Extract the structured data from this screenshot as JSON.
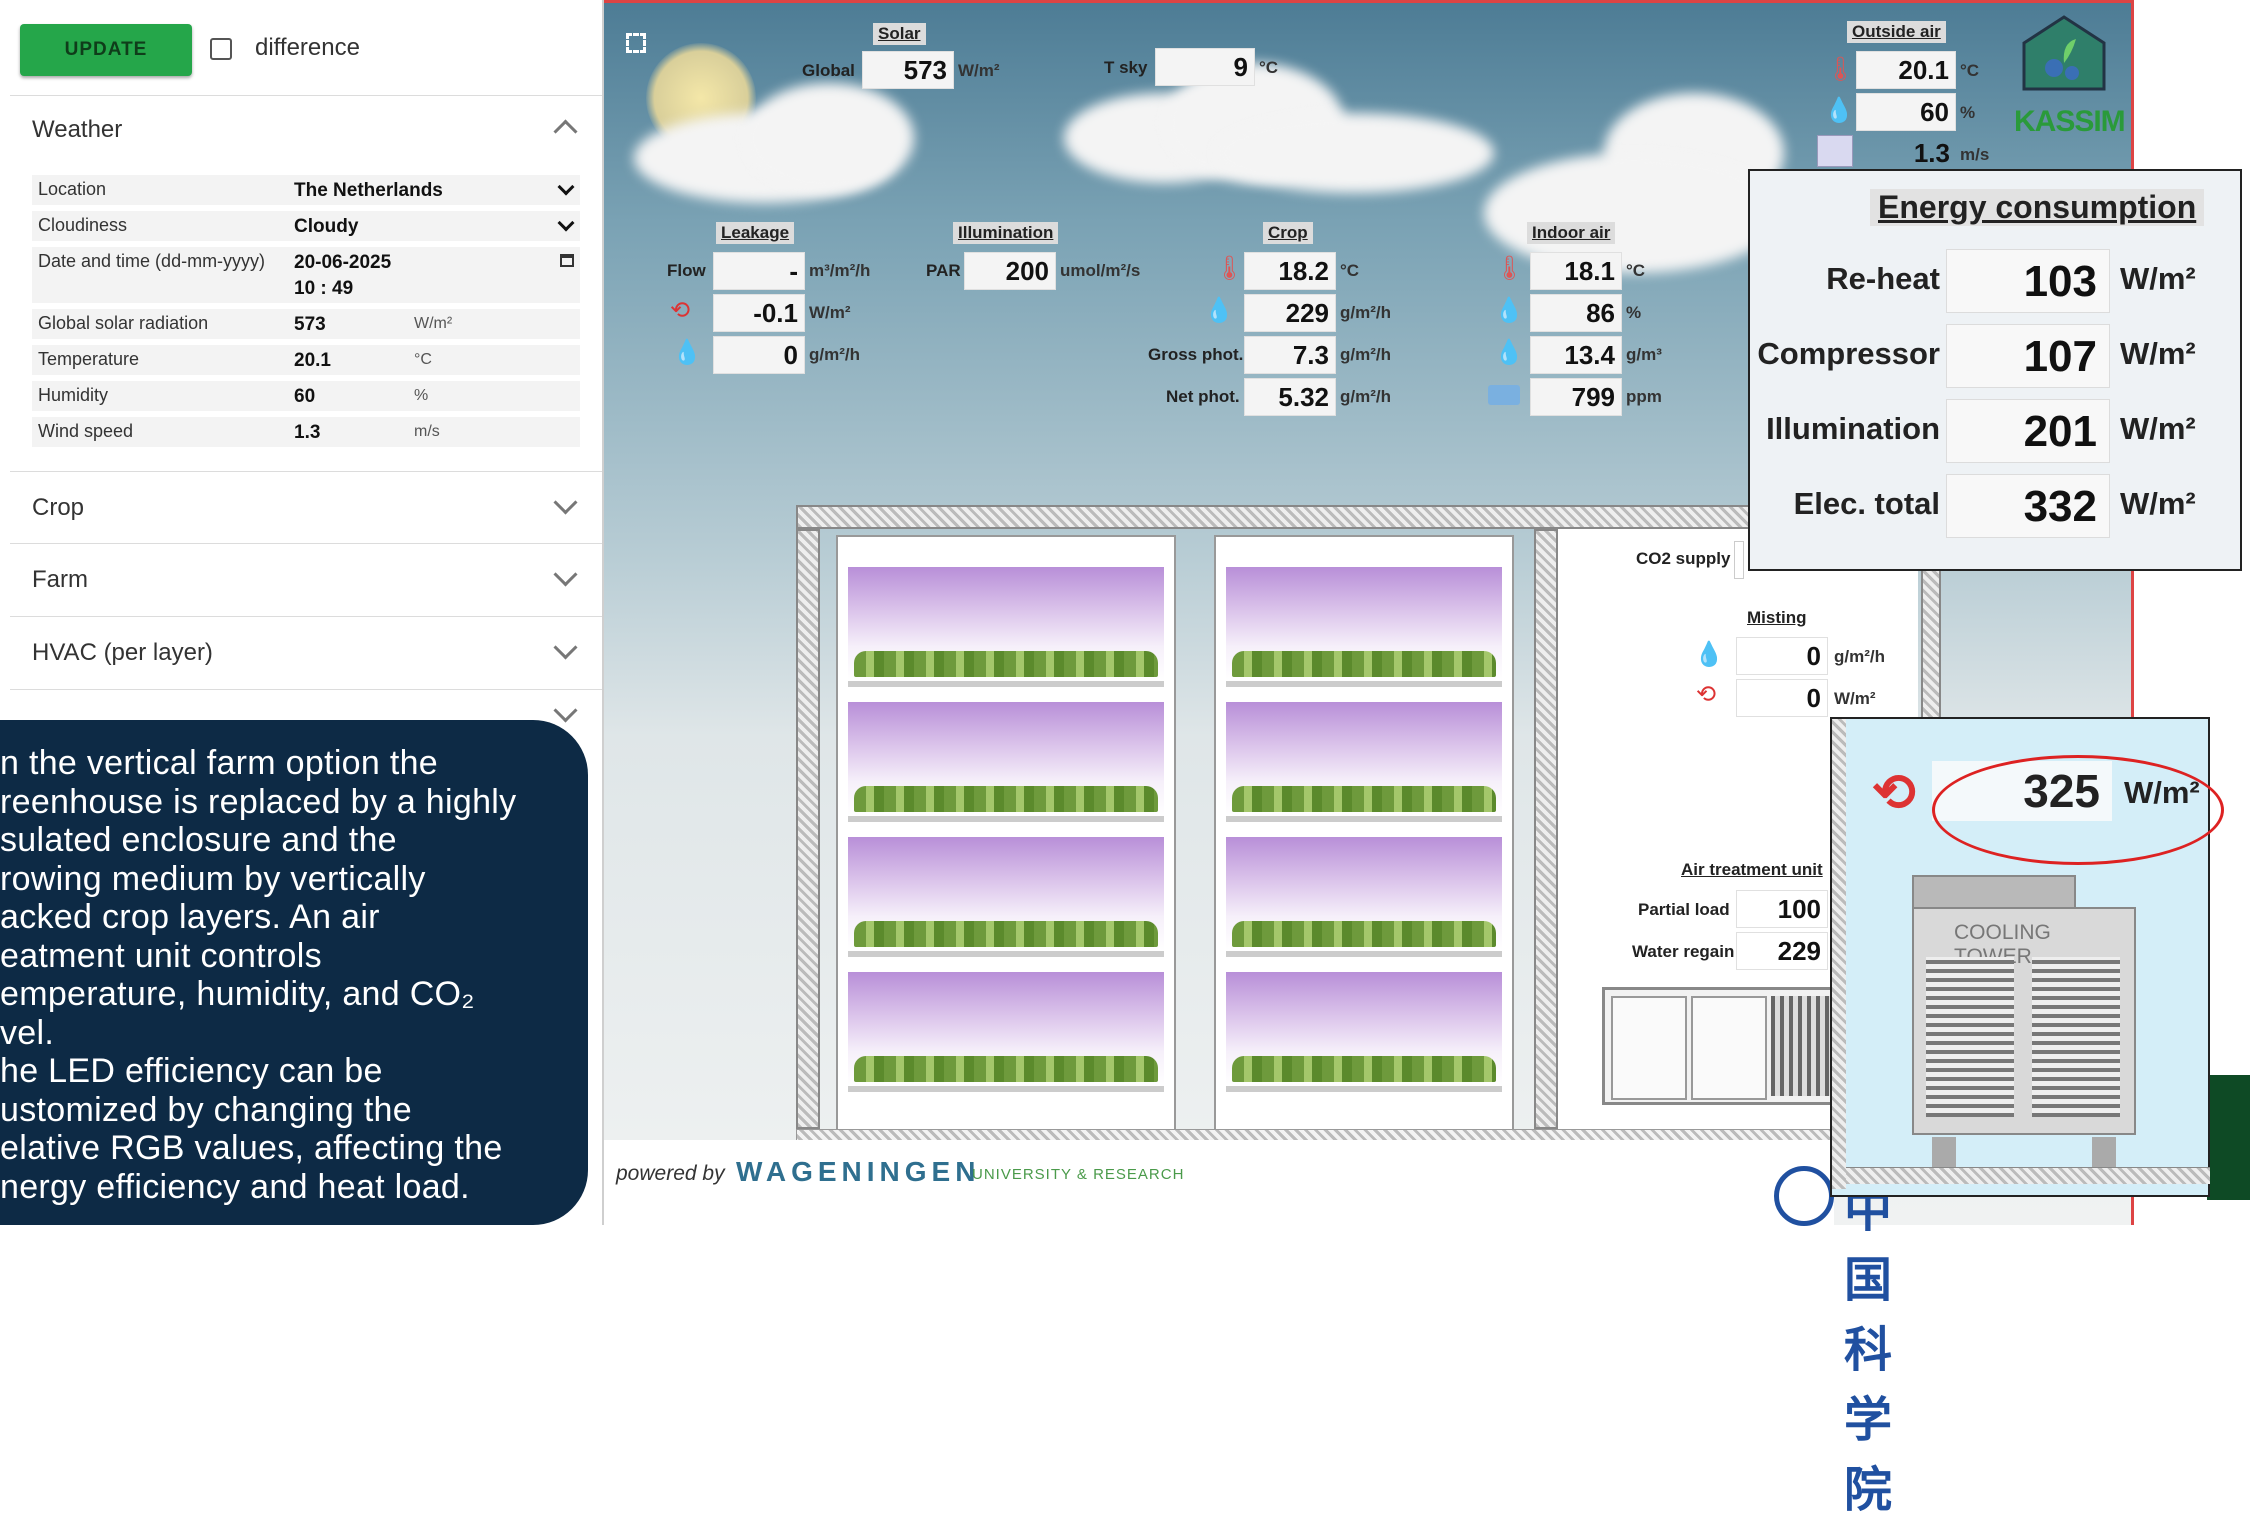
{
  "toolbar": {
    "update_label": "UPDATE",
    "difference_label": "difference"
  },
  "weather": {
    "title": "Weather",
    "rows": [
      {
        "label": "Location",
        "value": "The Netherlands",
        "unit": ""
      },
      {
        "label": "Cloudiness",
        "value": "Cloudy",
        "unit": ""
      },
      {
        "label": "Date and time (dd-mm-yyyy)",
        "value": "20-06-2025",
        "value2": "10 : 49",
        "unit": ""
      },
      {
        "label": "Global solar radiation",
        "value": "573",
        "unit": "W/m²"
      },
      {
        "label": "Temperature",
        "value": "20.1",
        "unit": "°C"
      },
      {
        "label": "Humidity",
        "value": "60",
        "unit": "%"
      },
      {
        "label": "Wind speed",
        "value": "1.3",
        "unit": "m/s"
      }
    ]
  },
  "sections": {
    "crop": "Crop",
    "farm": "Farm",
    "hvac": "HVAC (per layer)"
  },
  "tooltip": {
    "text": "n the vertical farm option the\nreenhouse is replaced by a highly\nsulated enclosure and the\nrowing medium by vertically\nacked crop layers.  An air\neatment unit controls\nemperature, humidity, and CO₂\nvel.\nhe LED efficiency can be\nustomized by changing the\nelative RGB values, affecting the\nnergy efficiency and heat load."
  },
  "solar": {
    "title": "Solar",
    "global_label": "Global",
    "global_value": "573",
    "global_unit": "W/m²",
    "tsky_label": "T sky",
    "tsky_value": "9",
    "tsky_unit": "°C"
  },
  "outside_air": {
    "title": "Outside air",
    "temp": "20.1",
    "temp_unit": "°C",
    "humidity": "60",
    "humidity_unit": "%",
    "wind": "1.3",
    "wind_unit": "m/s"
  },
  "brand": {
    "logo_text": "KASSIM"
  },
  "leakage": {
    "title": "Leakage",
    "flow_label": "Flow",
    "flow_value": "-",
    "flow_unit": "m³/m²/h",
    "heat_value": "-0.1",
    "heat_unit": "W/m²",
    "vapour_value": "0",
    "vapour_unit": "g/m²/h"
  },
  "illumination": {
    "title": "Illumination",
    "par_label": "PAR",
    "par_value": "200",
    "par_unit": "umol/m²/s"
  },
  "crop": {
    "title": "Crop",
    "temp": "18.2",
    "temp_unit": "°C",
    "transp": "229",
    "transp_unit": "g/m²/h",
    "gross_label": "Gross phot.",
    "gross": "7.3",
    "gross_unit": "g/m²/h",
    "net_label": "Net phot.",
    "net": "5.32",
    "net_unit": "g/m²/h"
  },
  "indoor_air": {
    "title": "Indoor air",
    "temp": "18.1",
    "temp_unit": "°C",
    "rh": "86",
    "rh_unit": "%",
    "abs_hum": "13.4",
    "abs_hum_unit": "g/m³",
    "co2": "799",
    "co2_unit": "ppm"
  },
  "co2_supply": {
    "label": "CO2 supply"
  },
  "misting": {
    "title": "Misting",
    "water": "0",
    "water_unit": "g/m²/h",
    "energy": "0",
    "energy_unit": "W/m²"
  },
  "air_treatment": {
    "title": "Air treatment unit",
    "partial_label": "Partial load",
    "partial_value": "100",
    "water_label": "Water regain",
    "water_value": "229"
  },
  "energy": {
    "title": "Energy consumption",
    "rows": [
      {
        "label": "Re-heat",
        "value": "103",
        "unit": "W/m²"
      },
      {
        "label": "Compressor",
        "value": "107",
        "unit": "W/m²"
      },
      {
        "label": "Illumination",
        "value": "201",
        "unit": "W/m²"
      },
      {
        "label": "Elec. total",
        "value": "332",
        "unit": "W/m²"
      }
    ]
  },
  "cooling_tower": {
    "value": "325",
    "unit": "W/m²",
    "label": "COOLING TOWER"
  },
  "footer": {
    "powered_by": "powered by",
    "brand": "WAGENINGEN",
    "brand_sub": "UNIVERSITY & RESEARCH",
    "cas_text": "中国科学院"
  },
  "colors": {
    "update_green": "#25a64a",
    "tooltip_bg": "#0d2a45",
    "border_red": "#dd4444",
    "ring_red": "#dd2222"
  }
}
